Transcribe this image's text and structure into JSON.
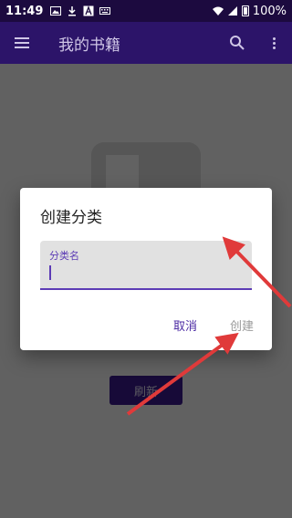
{
  "status_bar": {
    "time": "11:49",
    "icons": [
      "image-icon",
      "download-icon",
      "font-icon",
      "keyboard-icon"
    ],
    "battery": "100%"
  },
  "app_bar": {
    "title": "我的书籍",
    "menu_icon": "hamburger-icon",
    "search_icon": "search-icon",
    "more_icon": "more-vert-icon"
  },
  "background": {
    "refresh_label": "刷新"
  },
  "dialog": {
    "title": "创建分类",
    "field_label": "分类名",
    "field_value": "",
    "cancel_label": "取消",
    "create_label": "创建"
  },
  "colors": {
    "status_bar": "#1c0a3f",
    "app_bar": "#2c1469",
    "accent": "#5c3bb5",
    "arrow": "#e03a3a"
  }
}
